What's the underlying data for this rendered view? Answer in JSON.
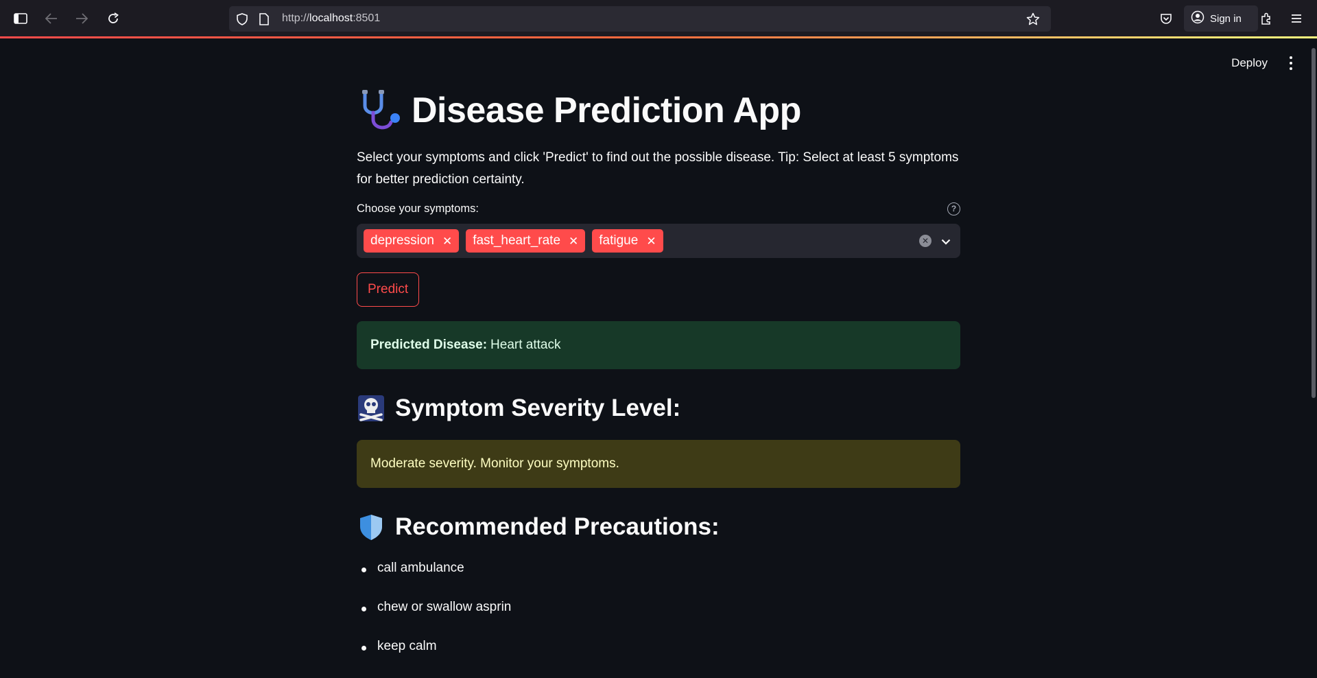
{
  "browser": {
    "url_prefix": "http://",
    "url_host": "localhost",
    "url_port": ":8501",
    "sign_in_label": "Sign in"
  },
  "app": {
    "deploy_label": "Deploy",
    "title": "Disease Prediction App",
    "title_icon": "stethoscope-emoji",
    "intro": "Select your symptoms and click 'Predict' to find out the possible disease. Tip: Select at least 5 symptoms for better prediction certainty.",
    "symptoms_label": "Choose your symptoms:",
    "selected_symptoms": [
      "depression",
      "fast_heart_rate",
      "fatigue"
    ],
    "predict_label": "Predict",
    "prediction": {
      "label": "Predicted Disease:",
      "value": "Heart attack"
    },
    "severity_heading": "Symptom Severity Level:",
    "severity_icon": "skull-crossbones-emoji",
    "severity_message": "Moderate severity. Monitor your symptoms.",
    "precautions_heading": "Recommended Precautions:",
    "precautions_icon": "shield-emoji",
    "precautions": [
      "call ambulance",
      "chew or swallow asprin",
      "keep calm"
    ]
  },
  "colors": {
    "accent": "#ff4b4b",
    "background": "#0e1117",
    "success_bg": "#173928",
    "warning_bg": "#3e3b16"
  }
}
